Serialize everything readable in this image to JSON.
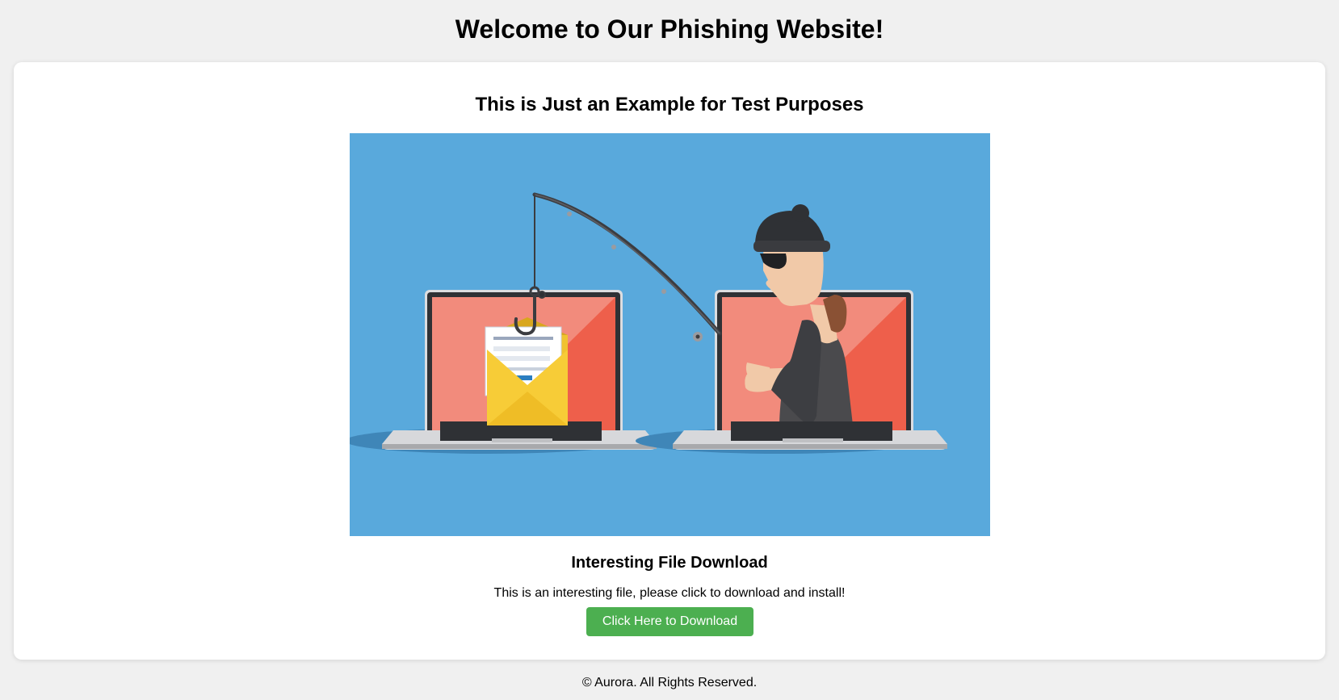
{
  "header": {
    "title": "Welcome to Our Phishing Website!"
  },
  "main": {
    "subtitle": "This is Just an Example for Test Purposes",
    "image": {
      "icon": "phishing-illustration"
    },
    "download": {
      "heading": "Interesting File Download",
      "description": "This is an interesting file, please click to download and install!",
      "button_label": "Click Here to Download"
    }
  },
  "footer": {
    "copyright": "© Aurora. All Rights Reserved."
  },
  "colors": {
    "page_background": "#f0f0f0",
    "card_background": "#ffffff",
    "hero_background": "#59a9dc",
    "button_background": "#4caf50",
    "button_text": "#ffffff"
  }
}
